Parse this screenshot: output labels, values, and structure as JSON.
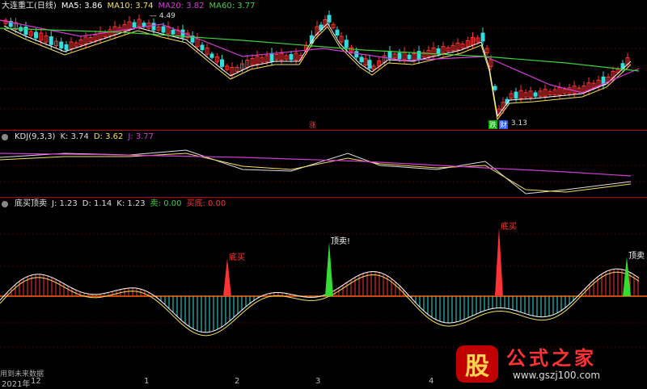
{
  "panels": {
    "main": {
      "title": "大连重工(日线)",
      "ma": [
        {
          "label": "MA5: 3.86",
          "color": "#ffffff"
        },
        {
          "label": "MA10: 3.74",
          "color": "#f5e15a"
        },
        {
          "label": "MA20: 3.82",
          "color": "#d23cd2"
        },
        {
          "label": "MA60: 3.77",
          "color": "#3cd23c"
        }
      ],
      "high_label": "4.49",
      "low_label": "3.13",
      "marker_up": "涨",
      "marker_dn": "跌",
      "marker_cai": "财"
    },
    "kdj": {
      "title": "KDJ(9,3,3)",
      "k": {
        "label": "K: 3.74",
        "color": "#dddddd"
      },
      "d": {
        "label": "D: 3.62",
        "color": "#f5e15a"
      },
      "j": {
        "label": "J: 3.77",
        "color": "#d23cd2"
      }
    },
    "ind": {
      "title": "底买顶卖",
      "j": {
        "label": "J: 1.23",
        "color": "#dddddd"
      },
      "d": {
        "label": "D: 1.14",
        "color": "#dddddd"
      },
      "k": {
        "label": "K: 1.23",
        "color": "#dddddd"
      },
      "sell": {
        "label": "卖: 0.00",
        "color": "#3cd23c"
      },
      "buy": {
        "label": "买底: 0.00",
        "color": "#ff3333"
      },
      "signals": [
        {
          "text": "底买",
          "color": "#ff3333"
        },
        {
          "text": "顶卖!",
          "color": "#ffffff"
        },
        {
          "text": "底买",
          "color": "#ff3333"
        },
        {
          "text": "顶卖",
          "color": "#ffffff"
        }
      ]
    }
  },
  "footer": {
    "note": "用到未来数据",
    "axis": [
      "2021年",
      "12",
      "1",
      "2",
      "3",
      "4"
    ]
  },
  "logo": {
    "badge": "股",
    "name": "公式之家",
    "url": "www.gszj100.com"
  },
  "colors": {
    "up": "#ff3333",
    "down": "#33dddd",
    "bg": "#000000",
    "separator": "#c00000"
  }
}
